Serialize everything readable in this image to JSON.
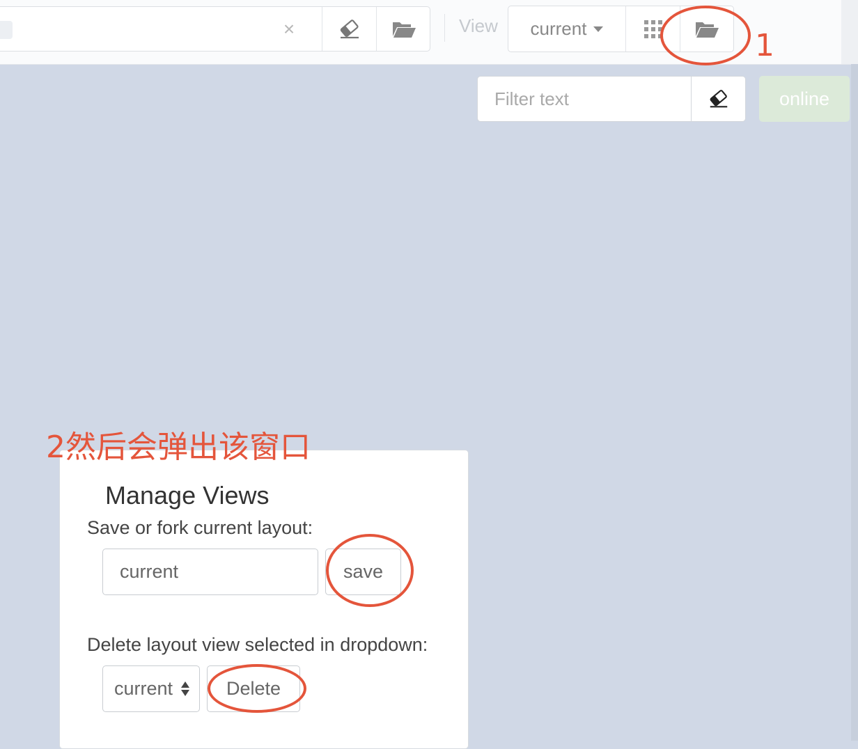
{
  "toolbar": {
    "search_value": "",
    "clear_symbol": "×",
    "eraser_icon": "eraser-icon",
    "open_icon": "folder-open-icon",
    "view_label": "View",
    "view_selected": "current",
    "grid_icon": "grid-icon",
    "manage_views_icon": "folder-open-icon"
  },
  "filter": {
    "placeholder": "Filter text",
    "value": "",
    "clear_icon": "eraser-icon",
    "online_label": "online"
  },
  "manage_views": {
    "title": "Manage Views",
    "save_label": "Save or fork current layout:",
    "view_name_value": "current",
    "save_button": "save",
    "delete_label": "Delete layout view selected in dropdown:",
    "delete_selected": "current",
    "delete_button": "Delete"
  },
  "annotations": {
    "step1": "1",
    "step2": "2然后会弹出该窗口",
    "color": "#e4553b"
  },
  "colors": {
    "background": "#d0d8e6",
    "online_button": "#dcead9",
    "annotation": "#e4553b"
  }
}
